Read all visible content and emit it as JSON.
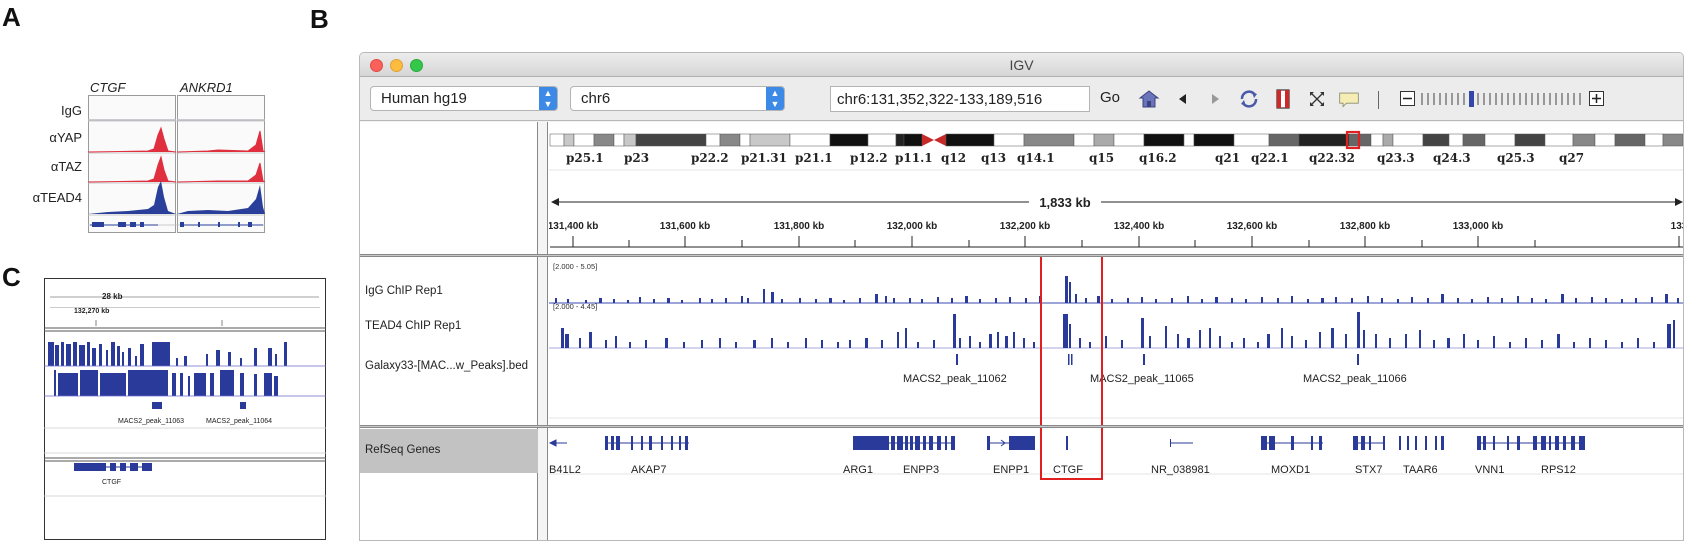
{
  "panel_letters": {
    "a": "A",
    "b": "B",
    "c": "C"
  },
  "panel_a": {
    "genes": [
      "CTGF",
      "ANKRD1"
    ],
    "rows": [
      {
        "label": "IgG",
        "color": "#b8b8c0"
      },
      {
        "label": "αYAP",
        "color": "#e0303f"
      },
      {
        "label": "αTAZ",
        "color": "#e0303f"
      },
      {
        "label": "αTEAD4",
        "color": "#2a3f9a"
      }
    ]
  },
  "panel_c": {
    "ruler_label": "28 kb",
    "tick_label": "132,270 kb",
    "peaks": [
      "MACS2_peak_11063",
      "MACS2_peak_11064"
    ],
    "gene": "CTGF",
    "track_color": "#2a3a9a"
  },
  "igv": {
    "title": "IGV",
    "genome": "Human hg19",
    "chromosome": "chr6",
    "locus": "chr6:131,352,322-133,189,516",
    "go_label": "Go",
    "icons": [
      "home-icon",
      "back-icon",
      "forward-icon",
      "refresh-icon",
      "roi-icon",
      "fit-icon",
      "popup-icon"
    ],
    "cytobands": [
      "p25.1",
      "p23",
      "p22.2",
      "p21.31",
      "p21.1",
      "p12.2",
      "p11.1",
      "q12",
      "q13",
      "q14.1",
      "q15",
      "q16.2",
      "q21",
      "q22.1",
      "q22.32",
      "q23.3",
      "q24.3",
      "q25.3",
      "q27"
    ],
    "span_label": "1,833 kb",
    "ruler_ticks": [
      "131,400 kb",
      "131,600 kb",
      "131,800 kb",
      "132,000 kb",
      "132,200 kb",
      "132,400 kb",
      "132,600 kb",
      "132,800 kb",
      "133,000 kb",
      "133"
    ],
    "tracks": [
      {
        "name": "IgG ChIP Rep1",
        "range": "[2.000 - 5.05]"
      },
      {
        "name": "TEAD4 ChIP Rep1",
        "range": "[2.000 - 4.45]"
      },
      {
        "name": "Galaxy33-[MAC...w_Peaks].bed",
        "range": ""
      }
    ],
    "peak_labels": [
      "MACS2_peak_11062",
      "MACS2_peak_11065",
      "MACS2_peak_11066"
    ],
    "refseq_label": "RefSeq Genes",
    "genes": [
      "B41L2",
      "AKAP7",
      "ARG1",
      "ENPP3",
      "ENPP1",
      "CTGF",
      "NR_038981",
      "MOXD1",
      "STX7",
      "TAAR6",
      "VNN1",
      "RPS12"
    ],
    "highlight_color": "#e02020",
    "track_color": "#2a3a9a"
  }
}
